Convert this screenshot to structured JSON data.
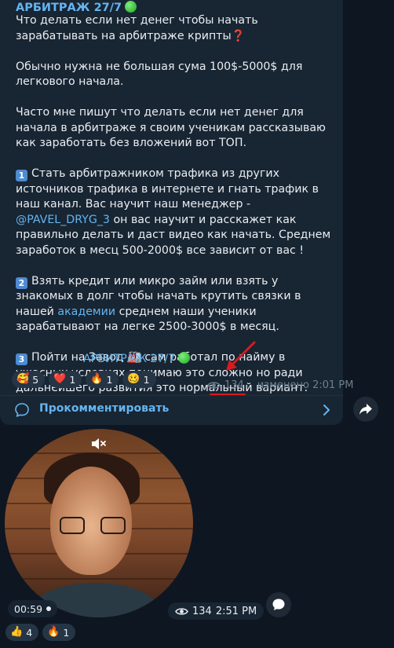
{
  "post": {
    "channel_name": "АРБИТРАЖ 27/7",
    "intro": "Что делать если нет денег чтобы начать зарабатывать на арбитраже крипты",
    "intro_mark": "❓",
    "para2": "Обычно нужна не большая сума 100$-5000$ для легкового начала.",
    "para3": "Часто мне пишут что делать если нет денег для начала в арбитраже я своим ученикам рассказываю как заработать без вложений вот ТОП.",
    "item1_num": "1",
    "item1_a": "Стать арбитражником трафика из других источников трафика в интернете и гнать трафик в наш канал. Вас научит наш менеджер - ",
    "item1_mention": "@PAVEL_DRYG_3",
    "item1_b": " он вас научит и расскажет как правильно делать и даст видео как начать. Среднем заработок в месц 500-2000$ все зависит от вас !",
    "item2_num": "2",
    "item2_a": "Взять кредит или микро займ или взять у знакомых в долг чтобы начать крутить связки в нашей ",
    "item2_link": "академии",
    "item2_b": " среднем наши ученики зарабатывают на легке 2500-3000$ в месяц.",
    "item3_num": "3",
    "item3_a": "Пойти на Завод ",
    "item3_emoji": "🏭",
    "item3_b": " сам работал по найму в ужасных условиях понимаю это сложно но ради дальнейшего развития это нормальный вариант.",
    "signature": "АРБИТРАЖ 27/7",
    "reactions": [
      {
        "emoji": "🥰",
        "count": "5",
        "icon": "smiling-hearts-emoji"
      },
      {
        "emoji": "❤️",
        "count": "1",
        "icon": "red-heart-emoji"
      },
      {
        "emoji": "🔥",
        "count": "1",
        "icon": "fire-emoji"
      },
      {
        "emoji": "🥴",
        "count": "1",
        "icon": "woozy-face-emoji"
      }
    ],
    "views": "134",
    "edited_time": "изменено 2:01 PM",
    "comment_label": "Прокомментировать"
  },
  "video_message": {
    "duration": "00:59",
    "views": "134",
    "time": "2:51 PM",
    "reactions": [
      {
        "emoji": "👍",
        "count": "4",
        "icon": "thumbs-up-emoji"
      },
      {
        "emoji": "🔥",
        "count": "1",
        "icon": "fire-emoji"
      }
    ]
  },
  "colors": {
    "background": "#0e1621",
    "bubble": "#182533",
    "accent_link": "#64b5ef",
    "meta_gray": "#6d7f8f",
    "annotation_red": "#d81b1b",
    "status_green": "#1ea41f"
  },
  "icons": [
    "eye-icon",
    "comment-icon",
    "chevron-right-icon",
    "share-arrow-icon",
    "mute-icon",
    "comment-bubble-icon",
    "red-annotation-arrow"
  ]
}
